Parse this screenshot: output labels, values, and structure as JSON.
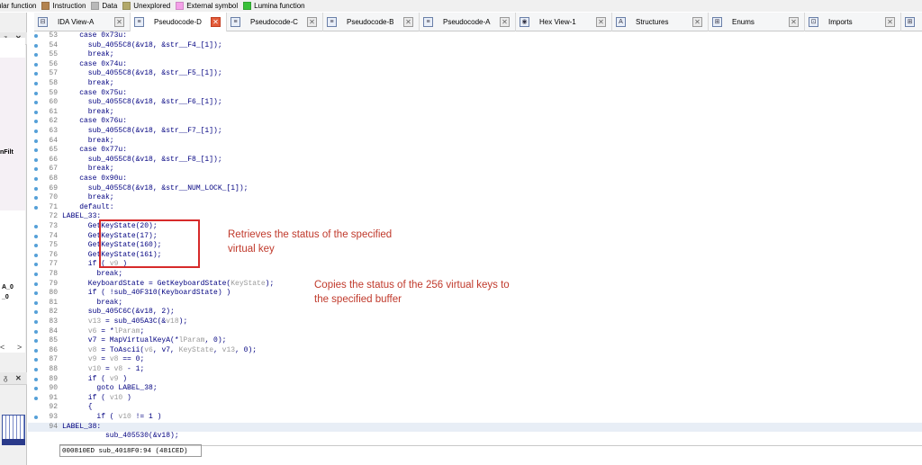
{
  "legend": [
    {
      "label": "egular function",
      "color": "#8fb6e6"
    },
    {
      "label": "Instruction",
      "color": "#b3834f"
    },
    {
      "label": "Data",
      "color": "#b9b9b9"
    },
    {
      "label": "Unexplored",
      "color": "#b2a86a"
    },
    {
      "label": "External symbol",
      "color": "#f4a0e8"
    },
    {
      "label": "Lumina function",
      "color": "#38c038"
    }
  ],
  "tabs": [
    {
      "label": "IDA View-A",
      "icon": "ida-view-icon"
    },
    {
      "label": "Pseudocode-D",
      "icon": "pseudocode-icon",
      "active": true
    },
    {
      "label": "Pseudocode-C",
      "icon": "pseudocode-icon"
    },
    {
      "label": "Pseudocode-B",
      "icon": "pseudocode-icon"
    },
    {
      "label": "Pseudocode-A",
      "icon": "pseudocode-icon"
    },
    {
      "label": "Hex View-1",
      "icon": "hex-view-icon"
    },
    {
      "label": "Structures",
      "icon": "structures-icon"
    },
    {
      "label": "Enums",
      "icon": "enums-icon"
    },
    {
      "label": "Imports",
      "icon": "imports-icon"
    }
  ],
  "left_panel": {
    "pin1": "ᵹ",
    "close1": "✕",
    "frag1": "nFilt",
    "frag2": "A_0",
    "frag3": "_0",
    "scroll_left": "<",
    "scroll_right": ">",
    "pin2": "ᵹ",
    "close2": "✕"
  },
  "code_lines": [
    {
      "num": "53",
      "text": "    case 0x73u:",
      "dot": true
    },
    {
      "num": "54",
      "text": "      sub_4055C8(&v18, &str__F4_[1]);",
      "dot": true
    },
    {
      "num": "55",
      "text": "      break;",
      "dot": true
    },
    {
      "num": "56",
      "text": "    case 0x74u:",
      "dot": true
    },
    {
      "num": "57",
      "text": "      sub_4055C8(&v18, &str__F5_[1]);",
      "dot": true
    },
    {
      "num": "58",
      "text": "      break;",
      "dot": true
    },
    {
      "num": "59",
      "text": "    case 0x75u:",
      "dot": true
    },
    {
      "num": "60",
      "text": "      sub_4055C8(&v18, &str__F6_[1]);",
      "dot": true
    },
    {
      "num": "61",
      "text": "      break;",
      "dot": true
    },
    {
      "num": "62",
      "text": "    case 0x76u:",
      "dot": true
    },
    {
      "num": "63",
      "text": "      sub_4055C8(&v18, &str__F7_[1]);",
      "dot": true
    },
    {
      "num": "64",
      "text": "      break;",
      "dot": true
    },
    {
      "num": "65",
      "text": "    case 0x77u:",
      "dot": true
    },
    {
      "num": "66",
      "text": "      sub_4055C8(&v18, &str__F8_[1]);",
      "dot": true
    },
    {
      "num": "67",
      "text": "      break;",
      "dot": true
    },
    {
      "num": "68",
      "text": "    case 0x90u:",
      "dot": true
    },
    {
      "num": "69",
      "text": "      sub_4055C8(&v18, &str__NUM_LOCK_[1]);",
      "dot": true
    },
    {
      "num": "70",
      "text": "      break;",
      "dot": true
    },
    {
      "num": "71",
      "text": "    default:",
      "dot": true
    },
    {
      "num": "72",
      "text": "LABEL_33:",
      "dot": false,
      "label": true
    },
    {
      "num": "73",
      "text": "      GetKeyState(20);",
      "dot": true
    },
    {
      "num": "74",
      "text": "      GetKeyState(17);",
      "dot": true
    },
    {
      "num": "75",
      "text": "      GetKeyState(160);",
      "dot": true
    },
    {
      "num": "76",
      "text": "      GetKeyState(161);",
      "dot": true
    },
    {
      "num": "77",
      "text": "      if ( v9 )",
      "dot": true
    },
    {
      "num": "78",
      "text": "        break;",
      "dot": true
    },
    {
      "num": "79",
      "text": "      KeyboardState = GetKeyboardState(KeyState);",
      "dot": true
    },
    {
      "num": "80",
      "text": "      if ( !sub_40F310(KeyboardState) )",
      "dot": true
    },
    {
      "num": "81",
      "text": "        break;",
      "dot": true
    },
    {
      "num": "82",
      "text": "      sub_405C6C(&v18, 2);",
      "dot": true
    },
    {
      "num": "83",
      "text": "      v13 = sub_405A3C(&v18);",
      "dot": true
    },
    {
      "num": "84",
      "text": "      v6 = *lParam;",
      "dot": true
    },
    {
      "num": "85",
      "text": "      v7 = MapVirtualKeyA(*lParam, 0);",
      "dot": true
    },
    {
      "num": "86",
      "text": "      v8 = ToAscii(v6, v7, KeyState, v13, 0);",
      "dot": true
    },
    {
      "num": "87",
      "text": "      v9 = v8 == 0;",
      "dot": true
    },
    {
      "num": "88",
      "text": "      v10 = v8 - 1;",
      "dot": true
    },
    {
      "num": "89",
      "text": "      if ( v9 )",
      "dot": true
    },
    {
      "num": "90",
      "text": "        goto LABEL_38;",
      "dot": true
    },
    {
      "num": "91",
      "text": "      if ( v10 )",
      "dot": true
    },
    {
      "num": "92",
      "text": "      {",
      "dot": false
    },
    {
      "num": "93",
      "text": "        if ( v10 != 1 )",
      "dot": true
    },
    {
      "num": "94",
      "text": "LABEL_38:",
      "dot": false,
      "label": true,
      "highlight": true
    },
    {
      "num": "",
      "text": "          sub_405530(&v18);",
      "dot": false
    }
  ],
  "annotations": {
    "first": "Retrieves the status of the specified virtual key",
    "first_line1": "Retrieves the status of the specified",
    "first_line2": "virtual key",
    "second_line1": "Copies the status of the 256 virtual keys to",
    "second_line2": "the specified buffer"
  },
  "status_bar": {
    "text": "000810ED sub_4018F0:94 (481CED)"
  },
  "colors": {
    "annotation": "#c0392b",
    "box": "#d72a2a",
    "code": "#000080",
    "line_number": "#7c7c7c",
    "dot": "#55a0d8"
  }
}
